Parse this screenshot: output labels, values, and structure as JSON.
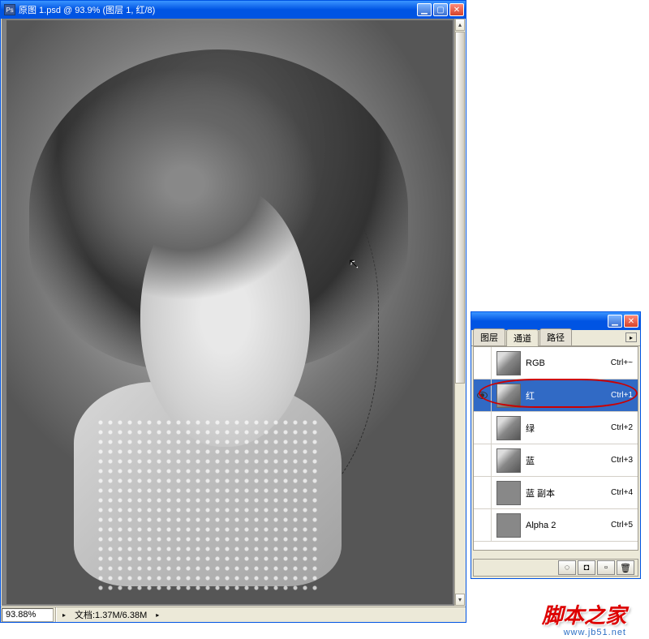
{
  "doc": {
    "title": "原图 1.psd @ 93.9% (图层 1, 红/8)",
    "zoom": "93.88%",
    "info": "文档:1.37M/6.38M"
  },
  "panel": {
    "tabs": {
      "layers": "图层",
      "channels": "通道",
      "paths": "路径"
    },
    "active_tab": "channels"
  },
  "channels": [
    {
      "name": "RGB",
      "shortcut": "Ctrl+~",
      "visible": false,
      "selected": false
    },
    {
      "name": "红",
      "shortcut": "Ctrl+1",
      "visible": true,
      "selected": true
    },
    {
      "name": "绿",
      "shortcut": "Ctrl+2",
      "visible": false,
      "selected": false
    },
    {
      "name": "蓝",
      "shortcut": "Ctrl+3",
      "visible": false,
      "selected": false
    },
    {
      "name": "蓝 副本",
      "shortcut": "Ctrl+4",
      "visible": false,
      "selected": false
    },
    {
      "name": "Alpha 2",
      "shortcut": "Ctrl+5",
      "visible": false,
      "selected": false
    }
  ],
  "watermark": {
    "main": "脚本之家",
    "sub": "www.jb51.net"
  }
}
